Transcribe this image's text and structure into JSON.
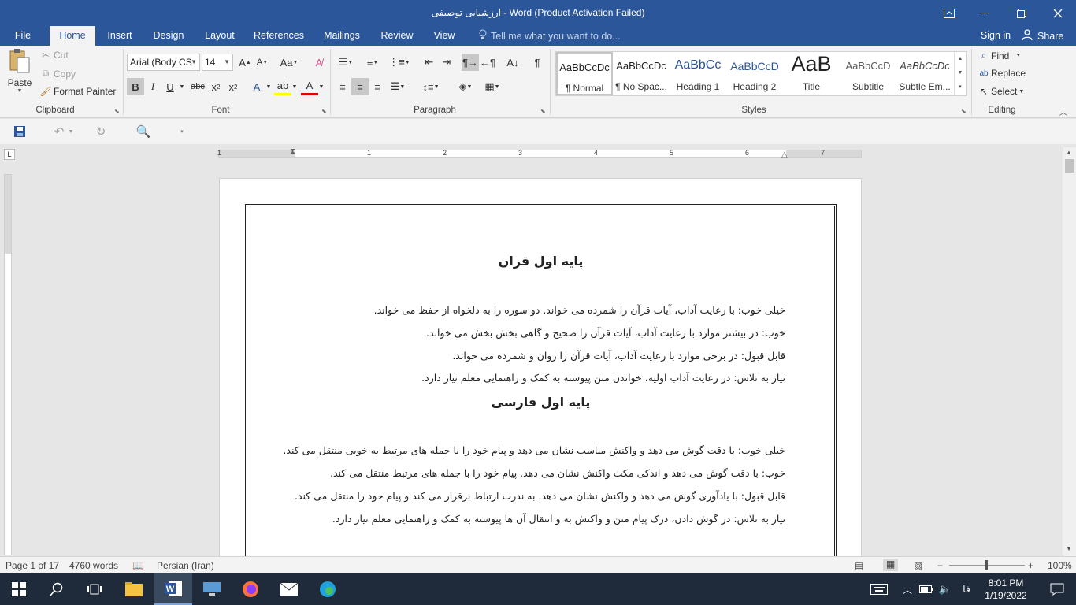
{
  "window": {
    "title": "ارزشیابی توصیفی - Word (Product Activation Failed)"
  },
  "tabs": [
    "File",
    "Home",
    "Insert",
    "Design",
    "Layout",
    "References",
    "Mailings",
    "Review",
    "View"
  ],
  "tell_me_placeholder": "Tell me what you want to do...",
  "sign_in": "Sign in",
  "share": "Share",
  "clipboard": {
    "paste": "Paste",
    "cut": "Cut",
    "copy": "Copy",
    "format_painter": "Format Painter",
    "label": "Clipboard"
  },
  "font": {
    "name": "Arial (Body CS",
    "size": "14",
    "label": "Font"
  },
  "paragraph": {
    "label": "Paragraph"
  },
  "styles": {
    "label": "Styles",
    "items": [
      {
        "preview": "AaBbCcDc",
        "name": "¶ Normal",
        "color": "#000000"
      },
      {
        "preview": "AaBbCcDc",
        "name": "¶ No Spac...",
        "color": "#000000"
      },
      {
        "preview": "AaBbCc",
        "name": "Heading 1",
        "color": "#2f5496"
      },
      {
        "preview": "AaBbCcD",
        "name": "Heading 2",
        "color": "#2f5496"
      },
      {
        "preview": "AaB",
        "name": "Title",
        "color": "#000000"
      },
      {
        "preview": "AaBbCcD",
        "name": "Subtitle",
        "color": "#595959"
      },
      {
        "preview": "AaBbCcDc",
        "name": "Subtle Em...",
        "color": "#404040"
      }
    ]
  },
  "editing": {
    "label": "Editing",
    "find": "Find",
    "replace": "Replace",
    "select": "Select"
  },
  "ruler": [
    "1",
    "1",
    "2",
    "3",
    "4",
    "5",
    "6",
    "7"
  ],
  "document": {
    "section1_title": "پایه اول قران",
    "section1_lines": [
      "خیلی خوب: با رعایت آداب، آیات قرآن را شمرده می خواند. دو سوره را به دلخواه از حفظ می خواند.",
      "خوب: در بیشتر موارد با رعایت آداب، آیات قرآن را صحیح و گاهی بخش بخش می خواند.",
      "قابل قبول: در برخی موارد با رعایت آداب، آیات قرآن را روان و شمرده می خواند.",
      "نیاز به تلاش: در رعایت آداب اولیه، خواندن متن پیوسته به کمک و راهنمایی معلم نیاز دارد."
    ],
    "section2_title": "پایه اول فارسی",
    "section2_lines": [
      "خیلی خوب: با دقت گوش می دهد و واکنش مناسب نشان می دهد و پیام خود را با جمله های مرتبط به خوبی منتقل می کند.",
      "خوب: با دقت گوش می دهد و اندکی مکث واکنش نشان می دهد. پیام خود را با جمله های مرتبط منتقل می کند.",
      "قابل قبول: با یادآوری گوش می دهد و واکنش نشان می دهد. به ندرت ارتباط برقرار می کند و پیام خود را منتقل می کند.",
      "نیاز به تلاش: در گوش دادن، درک پیام متن و واکنش به و انتقال آن ها پیوسته به کمک و راهنمایی معلم نیاز دارد."
    ]
  },
  "status": {
    "page": "Page 1 of 17",
    "words": "4760 words",
    "language": "Persian (Iran)",
    "zoom": "100%"
  },
  "taskbar": {
    "lang": "فا",
    "time": "8:01 PM",
    "date": "1/19/2022"
  },
  "colors": {
    "accent": "#2b579a",
    "ribbon_bg": "#f3f3f3",
    "taskbar_bg": "#1f2b3a"
  }
}
